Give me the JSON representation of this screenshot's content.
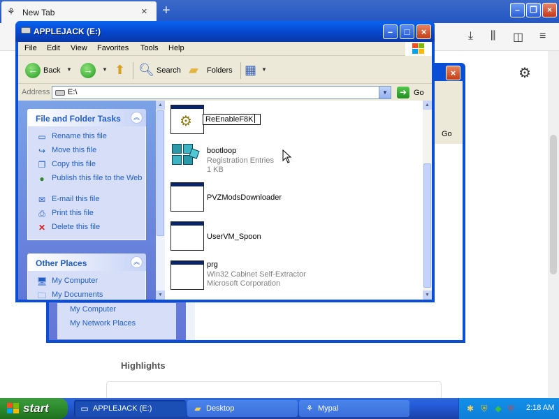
{
  "browser": {
    "tab_title": "New Tab",
    "tab_close": "×",
    "new_tab": "+",
    "highlights_heading": "Highlights"
  },
  "bg_window": {
    "links": [
      "My Computer",
      "My Network Places"
    ],
    "go_label": "Go"
  },
  "window": {
    "title": "APPLEJACK (E:)",
    "menu": [
      "File",
      "Edit",
      "View",
      "Favorites",
      "Tools",
      "Help"
    ],
    "toolbar": {
      "back": "Back",
      "search": "Search",
      "folders": "Folders"
    },
    "address": {
      "label": "Address",
      "value": "E:\\",
      "go": "Go"
    },
    "task_pane": {
      "file_tasks_title": "File and Folder Tasks",
      "file_tasks": [
        {
          "label": "Rename this file",
          "icon": "rename-icon"
        },
        {
          "label": "Move this file",
          "icon": "move-icon"
        },
        {
          "label": "Copy this file",
          "icon": "copy-icon"
        },
        {
          "label": "Publish this file to the Web",
          "icon": "globe-icon"
        },
        {
          "label": "E-mail this file",
          "icon": "email-icon"
        },
        {
          "label": "Print this file",
          "icon": "printer-icon"
        },
        {
          "label": "Delete this file",
          "icon": "delete-icon"
        }
      ],
      "other_places_title": "Other Places",
      "other_places": [
        {
          "label": "My Computer",
          "icon": "computer-icon"
        },
        {
          "label": "My Documents",
          "icon": "documents-icon"
        }
      ]
    },
    "files": [
      {
        "name": "ReEnableF8K",
        "renaming": true,
        "icon": "gear-window-icon"
      },
      {
        "name": "bootloop",
        "line2": "Registration Entries",
        "line3": "1 KB",
        "icon": "registry-icon"
      },
      {
        "name": "PVZModsDownloader",
        "icon": "app-window-icon"
      },
      {
        "name": "UserVM_Spoon",
        "icon": "app-window-icon"
      },
      {
        "name": "prg",
        "line2": "Win32 Cabinet Self-Extractor",
        "line3": "Microsoft Corporation",
        "icon": "app-window-icon"
      }
    ]
  },
  "taskbar": {
    "start_label": "start",
    "buttons": [
      {
        "label": "APPLEJACK (E:)",
        "active": true
      },
      {
        "label": "Desktop",
        "active": false
      },
      {
        "label": "Mypal",
        "active": false
      }
    ],
    "clock": "2:18 AM"
  },
  "colors": {
    "xp_blue": "#0b4ed6",
    "task_link": "#215dc6",
    "start_green": "#2f8f2f"
  }
}
